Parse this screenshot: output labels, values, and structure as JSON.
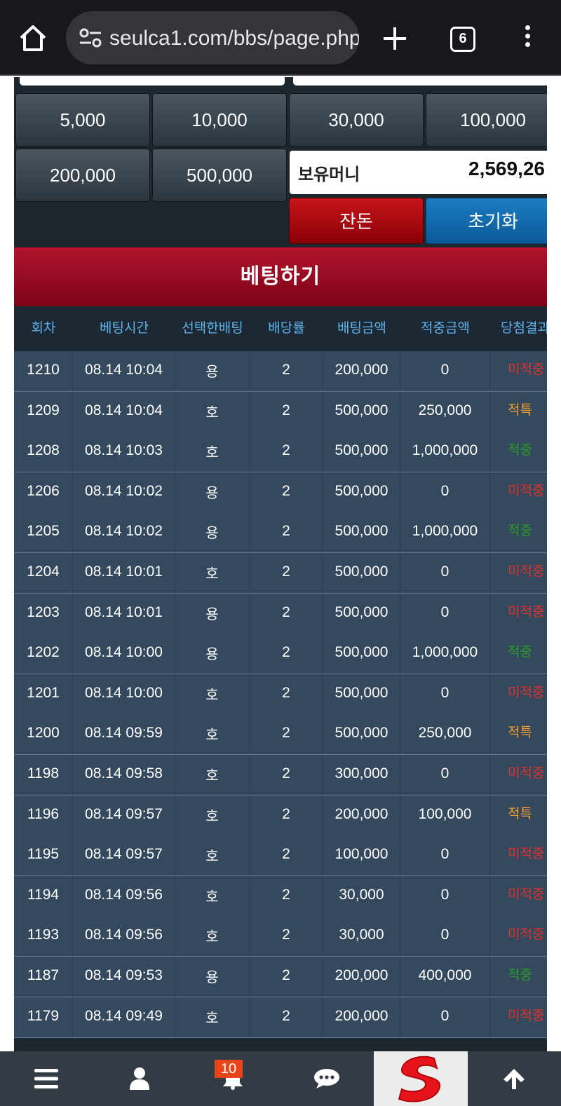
{
  "browser": {
    "url": "seulca1.com/bbs/page.php",
    "tab_count": "6"
  },
  "chips": [
    "5,000",
    "10,000",
    "30,000",
    "100,000",
    "200,000",
    "500,000"
  ],
  "balance": {
    "label": "보유머니",
    "value": "2,569,26"
  },
  "actions": {
    "change_label": "잔돈",
    "reset_label": "초기화"
  },
  "bet_button_label": "베팅하기",
  "table": {
    "headers": [
      "회차",
      "베팅시간",
      "선택한배팅",
      "배당률",
      "배팅금액",
      "적중금액",
      "당첨결과"
    ],
    "rows": [
      [
        "1210",
        "08.14 10:04",
        "용",
        "2",
        "200,000",
        "0",
        "미적중"
      ],
      [
        "1209",
        "08.14 10:04",
        "호",
        "2",
        "500,000",
        "250,000",
        "적특"
      ],
      [
        "1208",
        "08.14 10:03",
        "호",
        "2",
        "500,000",
        "1,000,000",
        "적중"
      ],
      [
        "1206",
        "08.14 10:02",
        "용",
        "2",
        "500,000",
        "0",
        "미적중"
      ],
      [
        "1205",
        "08.14 10:02",
        "용",
        "2",
        "500,000",
        "1,000,000",
        "적중"
      ],
      [
        "1204",
        "08.14 10:01",
        "호",
        "2",
        "500,000",
        "0",
        "미적중"
      ],
      [
        "1203",
        "08.14 10:01",
        "용",
        "2",
        "500,000",
        "0",
        "미적중"
      ],
      [
        "1202",
        "08.14 10:00",
        "용",
        "2",
        "500,000",
        "1,000,000",
        "적중"
      ],
      [
        "1201",
        "08.14 10:00",
        "호",
        "2",
        "500,000",
        "0",
        "미적중"
      ],
      [
        "1200",
        "08.14 09:59",
        "호",
        "2",
        "500,000",
        "250,000",
        "적특"
      ],
      [
        "1198",
        "08.14 09:58",
        "호",
        "2",
        "300,000",
        "0",
        "미적중"
      ],
      [
        "1196",
        "08.14 09:57",
        "호",
        "2",
        "200,000",
        "100,000",
        "적특"
      ],
      [
        "1195",
        "08.14 09:57",
        "호",
        "2",
        "100,000",
        "0",
        "미적중"
      ],
      [
        "1194",
        "08.14 09:56",
        "호",
        "2",
        "30,000",
        "0",
        "미적중"
      ],
      [
        "1193",
        "08.14 09:56",
        "호",
        "2",
        "30,000",
        "0",
        "미적중"
      ],
      [
        "1187",
        "08.14 09:53",
        "용",
        "2",
        "200,000",
        "400,000",
        "적중"
      ],
      [
        "1179",
        "08.14 09:49",
        "호",
        "2",
        "200,000",
        "0",
        "미적중"
      ]
    ]
  },
  "result_colors": {
    "미적중": "#e0312c",
    "적특": "#f0a030",
    "적중": "#2a9a2a"
  },
  "nav": {
    "notification_count": "10",
    "icons": [
      "menu-icon",
      "user-icon",
      "bell-icon",
      "chat-icon",
      "logo",
      "arrow-up-icon"
    ]
  }
}
